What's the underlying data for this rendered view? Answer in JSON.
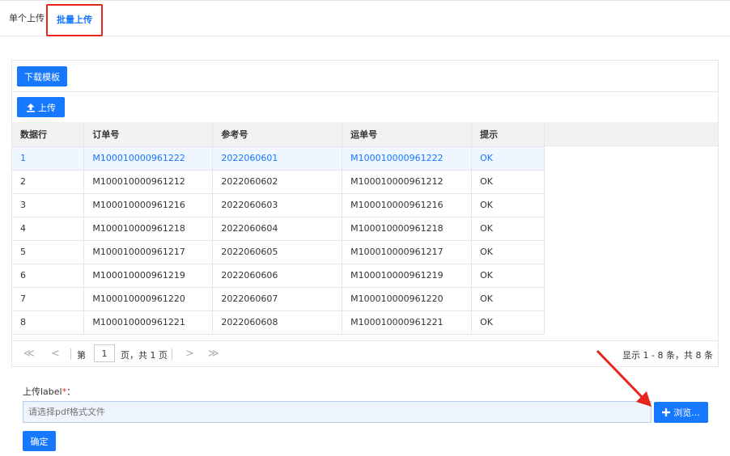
{
  "tabs": {
    "single": "单个上传",
    "batch": "批量上传"
  },
  "toolbar": {
    "download_template": "下载模板",
    "upload": "上传"
  },
  "table": {
    "headers": [
      "数据行",
      "订单号",
      "参考号",
      "运单号",
      "提示"
    ],
    "rows": [
      [
        "1",
        "M100010000961222",
        "2022060601",
        "M100010000961222",
        "OK"
      ],
      [
        "2",
        "M100010000961212",
        "2022060602",
        "M100010000961212",
        "OK"
      ],
      [
        "3",
        "M100010000961216",
        "2022060603",
        "M100010000961216",
        "OK"
      ],
      [
        "4",
        "M100010000961218",
        "2022060604",
        "M100010000961218",
        "OK"
      ],
      [
        "5",
        "M100010000961217",
        "2022060605",
        "M100010000961217",
        "OK"
      ],
      [
        "6",
        "M100010000961219",
        "2022060606",
        "M100010000961219",
        "OK"
      ],
      [
        "7",
        "M100010000961220",
        "2022060607",
        "M100010000961220",
        "OK"
      ],
      [
        "8",
        "M100010000961221",
        "2022060608",
        "M100010000961221",
        "OK"
      ]
    ],
    "selected_row": 0
  },
  "pager": {
    "first": "≪",
    "prev": "<",
    "next": ">",
    "last": "≫",
    "page_prefix": "第",
    "page_value": "1",
    "page_suffix": "页，共 1 页",
    "info": "显示 1 - 8 条，共 8 条"
  },
  "upload": {
    "label": "上传label",
    "required_mark": "*",
    "colon": "：",
    "placeholder": "请选择pdf格式文件",
    "browse": "浏览...",
    "confirm": "确定"
  },
  "colors": {
    "primary": "#1677ff",
    "highlight": "#e6251f"
  }
}
